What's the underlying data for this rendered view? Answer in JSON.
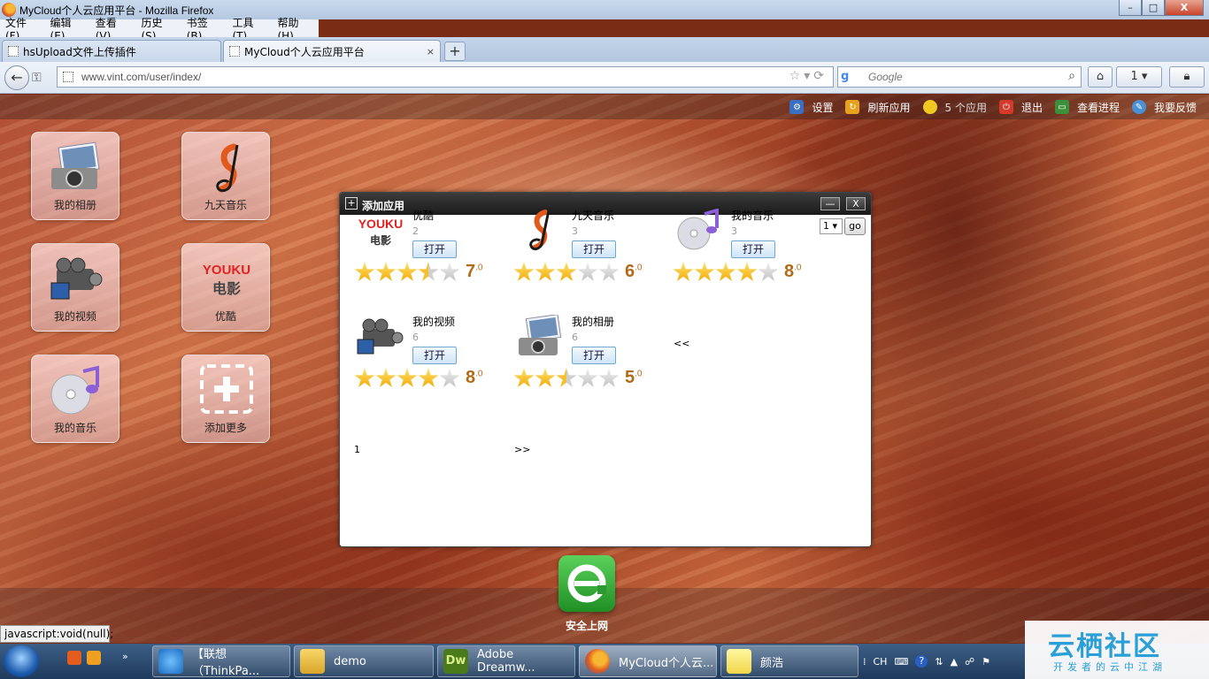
{
  "window": {
    "title": "MyCloud个人云应用平台 - Mozilla Firefox",
    "minimize": "–",
    "maximize": "□",
    "close": "X"
  },
  "menu": [
    "文件(F)",
    "编辑(E)",
    "查看(V)",
    "历史(S)",
    "书签(B)",
    "工具(T)",
    "帮助(H)"
  ],
  "tabs": [
    {
      "label": "hsUpload文件上传插件"
    },
    {
      "label": "MyCloud个人云应用平台"
    }
  ],
  "tab_close": "×",
  "new_tab": "+",
  "navbar": {
    "url": "www.vint.com/user/index/",
    "search_placeholder": "Google",
    "home": "⌂",
    "bookmark_count": "1"
  },
  "toplinks": [
    {
      "label": "设置",
      "icon": "gear-icon",
      "color": "#3a6fc2"
    },
    {
      "label": "刷新应用",
      "icon": "refresh-icon",
      "color": "#e6a21d"
    },
    {
      "label": "5 个应用",
      "icon": "coin-icon",
      "color": "#f0c820"
    },
    {
      "label": "退出",
      "icon": "power-icon",
      "color": "#d43a2a"
    },
    {
      "label": "查看进程",
      "icon": "monitor-icon",
      "color": "#3d8f3a"
    },
    {
      "label": "我要反馈",
      "icon": "feedback-icon",
      "color": "#4a90d4"
    }
  ],
  "desktop": [
    {
      "label": "我的相册",
      "icon": "camera-photo-icon"
    },
    {
      "label": "九天音乐",
      "icon": "music-note-icon"
    },
    {
      "label": "我的视频",
      "icon": "video-camera-icon"
    },
    {
      "label": "优酷",
      "icon": "youku-icon"
    },
    {
      "label": "我的音乐",
      "icon": "cd-music-icon"
    },
    {
      "label": "添加更多",
      "icon": "add-more-icon"
    }
  ],
  "dock": {
    "label": "安全上网"
  },
  "dialog": {
    "title": "添加应用",
    "minimize": "—",
    "close": "X",
    "page_select": "1",
    "go": "go",
    "prev": "<<",
    "next": ">>",
    "page_number": "1",
    "open_label": "打开",
    "apps": [
      {
        "name": "优酷",
        "count": "2",
        "rating": 3.5,
        "score": "7",
        "score_dec": ".0"
      },
      {
        "name": "九天音乐",
        "count": "3",
        "rating": 3,
        "score": "6",
        "score_dec": ".0"
      },
      {
        "name": "我的音乐",
        "count": "3",
        "rating": 4,
        "score": "8",
        "score_dec": ".0"
      },
      {
        "name": "我的视频",
        "count": "6",
        "rating": 4,
        "score": "8",
        "score_dec": ".0"
      },
      {
        "name": "我的相册",
        "count": "6",
        "rating": 2.5,
        "score": "5",
        "score_dec": ".0"
      }
    ]
  },
  "status_text": "javascript:void(null);",
  "taskbar": [
    {
      "label": "【联想（ThinkPa..."
    },
    {
      "label": "demo"
    },
    {
      "label": "Adobe Dreamw..."
    },
    {
      "label": "MyCloud个人云..."
    },
    {
      "label": "颜浩"
    }
  ],
  "tray": {
    "lang": "CH"
  },
  "watermark": {
    "big": "云栖社区",
    "small": "开发者的云中江湖"
  },
  "logo_text": {
    "youku_top": "YOUKU",
    "youku_bottom": "电影",
    "dw": "Dw"
  }
}
